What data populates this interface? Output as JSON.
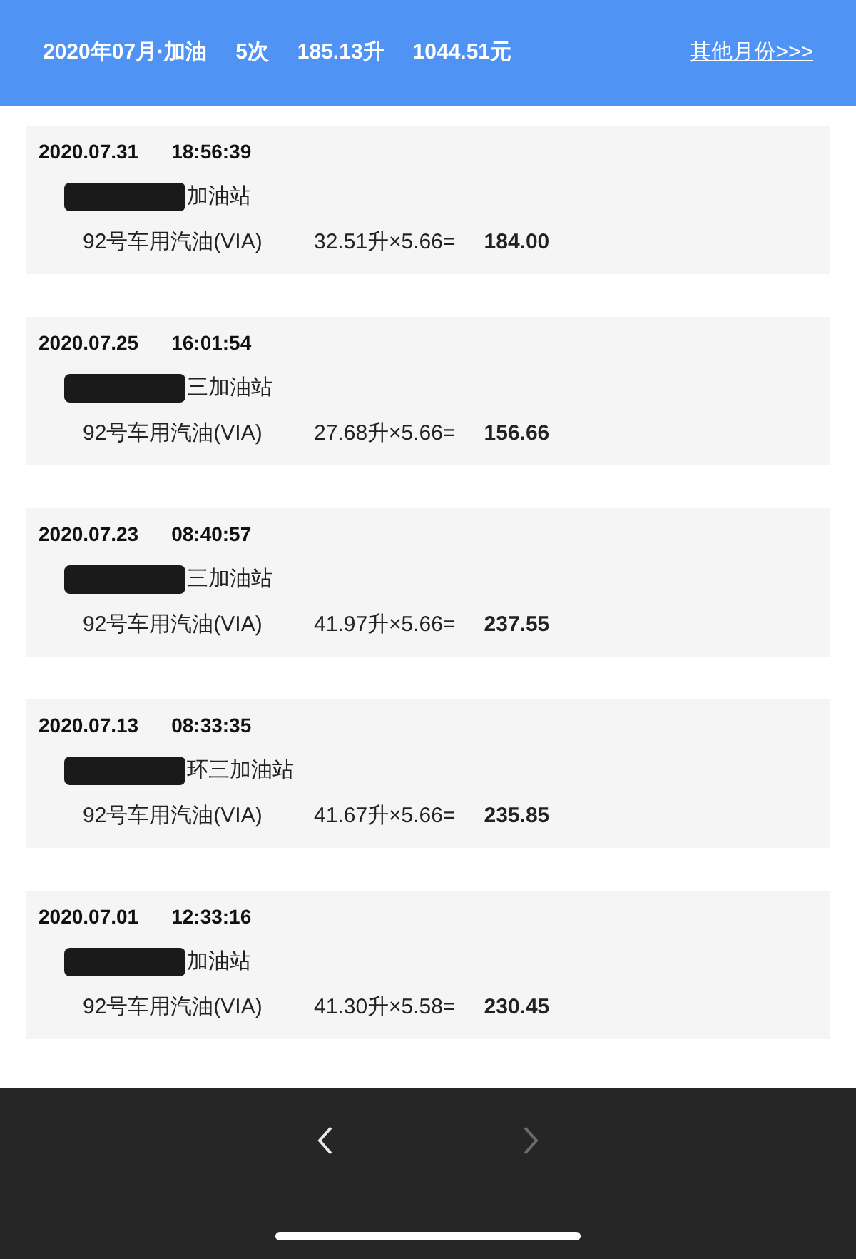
{
  "header": {
    "summary": [
      "2020年07月·加油",
      "5次",
      "185.13升",
      "1044.51元"
    ],
    "other_months_link": "其他月份>>>"
  },
  "records": [
    {
      "date": "2020.07.31",
      "time": "18:56:39",
      "station": "加油站",
      "fuel": "92号车用汽油(VIA)",
      "calculation": "32.51升×5.66=",
      "total": "184.00"
    },
    {
      "date": "2020.07.25",
      "time": "16:01:54",
      "station": "三加油站",
      "fuel": "92号车用汽油(VIA)",
      "calculation": "27.68升×5.66=",
      "total": "156.66"
    },
    {
      "date": "2020.07.23",
      "time": "08:40:57",
      "station": "三加油站",
      "fuel": "92号车用汽油(VIA)",
      "calculation": "41.97升×5.66=",
      "total": "237.55"
    },
    {
      "date": "2020.07.13",
      "time": "08:33:35",
      "station": "环三加油站",
      "fuel": "92号车用汽油(VIA)",
      "calculation": "41.67升×5.66=",
      "total": "235.85"
    },
    {
      "date": "2020.07.01",
      "time": "12:33:16",
      "station": "加油站",
      "fuel": "92号车用汽油(VIA)",
      "calculation": "41.30升×5.58=",
      "total": "230.45"
    }
  ],
  "bottom_nav": [
    {
      "kind": "back",
      "disabled": false
    },
    {
      "kind": "forward",
      "disabled": true
    }
  ]
}
